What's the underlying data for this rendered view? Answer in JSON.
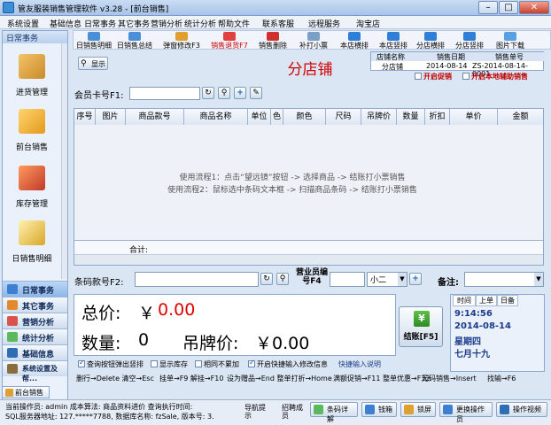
{
  "window": {
    "title": "管友服装销售管理软件 v3.28 - [前台销售]"
  },
  "menu": [
    "系统设置",
    "基础信息",
    "日常事务",
    "其它事务",
    "营销分析",
    "统计分析",
    "帮助文件",
    "联系客服",
    "远程服务",
    "淘宝店"
  ],
  "sidebar": {
    "header": "日常事务",
    "items": [
      "进货管理",
      "前台销售",
      "库存管理",
      "日销售明细"
    ],
    "tabs": [
      "日常事务",
      "其它事务",
      "营销分析",
      "统计分析",
      "基础信息",
      "系统设置及帮..."
    ]
  },
  "toolbar": [
    "日销售明细",
    "日销售总结",
    "弹窗修改F3",
    "销售退货F7",
    "销售删除",
    "补打小票",
    "本店横排",
    "本店竖排",
    "分店横排",
    "分店竖排",
    "图片下载"
  ],
  "show_button": "显示",
  "store_title": "分店铺",
  "store_table": {
    "headers": [
      "店铺名称",
      "销售日期",
      "销售单号"
    ],
    "values": [
      "分店铺",
      "2014-08-14",
      "ZS-2014-08-14-0001"
    ]
  },
  "promo_checks": [
    "开启促销",
    "开启本地辅助销售"
  ],
  "member_label": "会员卡号F1:",
  "columns": [
    "序号",
    "图片",
    "商品款号",
    "商品名称",
    "单位",
    "色",
    "颜色",
    "尺码",
    "吊牌价",
    "数量",
    "折扣",
    "单价",
    "金额"
  ],
  "hints": [
    "使用流程1：点击“望远镜”按钮 -> 选择商品 -> 结账打小票销售",
    "使用流程2：鼠标选中条码文本框 -> 扫描商品条码 -> 结账打小票销售"
  ],
  "subtotal_label": "合计:",
  "barcode_label": "条码款号F2:",
  "salesperson_label": "营业员编号F4",
  "salesperson_value": "小二",
  "remark_label": "备注:",
  "total": {
    "label": "总价:",
    "currency": "￥",
    "value": "0.00"
  },
  "quantity": {
    "label": "数量:",
    "value": "0"
  },
  "tag_price": {
    "label": "吊牌价:",
    "value": "￥0.00"
  },
  "checkout_button": "结账[F5]",
  "calendar": {
    "tabs": [
      "时间",
      "上单",
      "日备"
    ],
    "time": "9:14:56",
    "date": "2014-08-14",
    "weekday": "星期四",
    "lunar": "七月十九"
  },
  "checkboxes": [
    {
      "label": "查询按钮弹出竖排",
      "checked": true
    },
    {
      "label": "显示库存",
      "checked": false
    },
    {
      "label": "相同不累加",
      "checked": false
    },
    {
      "label": "开启快捷输入修改信息",
      "checked": true
    },
    {
      "label": "快捷输入说明",
      "checked": false
    }
  ],
  "doc_tab": "前台销售",
  "shortcuts": [
    "删行→Delete 清空→Esc",
    "挂单→F9 解挂→F10",
    "设为赠品→End 整单打折→Home",
    "满额促销→F11 整单优惠→F12",
    "无码销售→Insert",
    "找输→F6"
  ],
  "status": {
    "line1": "当前操作员: admin 成本算法: 商品资料进价 查询执行时间:",
    "line2": "SQL服务器地址: 127.*****7788, 数据库名称: fzSale, 版本号: 3.",
    "mid": [
      "导航提示",
      "招聘成员"
    ]
  },
  "status_buttons": [
    "条码详解",
    "钱箱",
    "锁屏",
    "更换操作员",
    "操作视频"
  ]
}
